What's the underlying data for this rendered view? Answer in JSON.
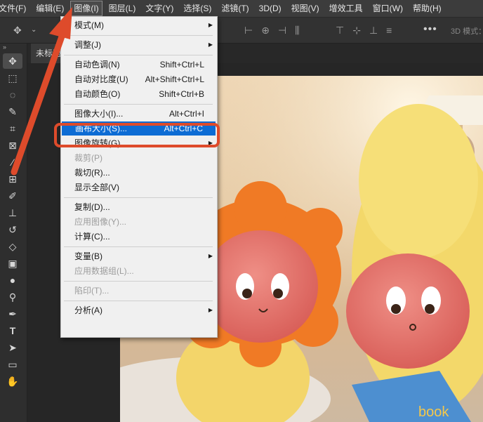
{
  "menubar": {
    "items": [
      "文件(F)",
      "编辑(E)",
      "图像(I)",
      "图层(L)",
      "文字(Y)",
      "选择(S)",
      "滤镜(T)",
      "3D(D)",
      "视图(V)",
      "增效工具",
      "窗口(W)",
      "帮助(H)"
    ],
    "active_index": 2
  },
  "options_bar": {
    "move_icon": "move-icon",
    "more_label": "•••",
    "mode_3d_label": "3D 模式："
  },
  "toolbar": {
    "collapse_label": "»",
    "tools": [
      "move-tool",
      "marquee-tool",
      "lasso-tool",
      "quick-select-tool",
      "crop-tool",
      "frame-tool",
      "eyedropper-tool",
      "healing-tool",
      "brush-tool",
      "stamp-tool",
      "history-brush-tool",
      "eraser-tool",
      "gradient-tool",
      "blur-tool",
      "dodge-tool",
      "pen-tool",
      "type-tool",
      "path-select-tool",
      "shape-tool",
      "hand-tool"
    ]
  },
  "tabs": {
    "document_tab": "未标题"
  },
  "image_menu": {
    "items": [
      {
        "label": "模式(M)",
        "shortcut": "",
        "submenu": true,
        "disabled": false,
        "highlighted": false
      },
      {
        "separator": true
      },
      {
        "label": "调整(J)",
        "shortcut": "",
        "submenu": true,
        "disabled": false,
        "highlighted": false
      },
      {
        "separator": true
      },
      {
        "label": "自动色调(N)",
        "shortcut": "Shift+Ctrl+L",
        "submenu": false,
        "disabled": false,
        "highlighted": false
      },
      {
        "label": "自动对比度(U)",
        "shortcut": "Alt+Shift+Ctrl+L",
        "submenu": false,
        "disabled": false,
        "highlighted": false
      },
      {
        "label": "自动颜色(O)",
        "shortcut": "Shift+Ctrl+B",
        "submenu": false,
        "disabled": false,
        "highlighted": false
      },
      {
        "separator": true
      },
      {
        "label": "图像大小(I)...",
        "shortcut": "Alt+Ctrl+I",
        "submenu": false,
        "disabled": false,
        "highlighted": false
      },
      {
        "label": "画布大小(S)...",
        "shortcut": "Alt+Ctrl+C",
        "submenu": false,
        "disabled": false,
        "highlighted": true
      },
      {
        "label": "图像旋转(G)",
        "shortcut": "",
        "submenu": true,
        "disabled": false,
        "highlighted": false
      },
      {
        "label": "裁剪(P)",
        "shortcut": "",
        "submenu": false,
        "disabled": true,
        "highlighted": false
      },
      {
        "label": "裁切(R)...",
        "shortcut": "",
        "submenu": false,
        "disabled": false,
        "highlighted": false
      },
      {
        "label": "显示全部(V)",
        "shortcut": "",
        "submenu": false,
        "disabled": false,
        "highlighted": false
      },
      {
        "separator": true
      },
      {
        "label": "复制(D)...",
        "shortcut": "",
        "submenu": false,
        "disabled": false,
        "highlighted": false
      },
      {
        "label": "应用图像(Y)...",
        "shortcut": "",
        "submenu": false,
        "disabled": true,
        "highlighted": false
      },
      {
        "label": "计算(C)...",
        "shortcut": "",
        "submenu": false,
        "disabled": false,
        "highlighted": false
      },
      {
        "separator": true
      },
      {
        "label": "变量(B)",
        "shortcut": "",
        "submenu": true,
        "disabled": false,
        "highlighted": false
      },
      {
        "label": "应用数据组(L)...",
        "shortcut": "",
        "submenu": false,
        "disabled": true,
        "highlighted": false
      },
      {
        "separator": true
      },
      {
        "label": "陷印(T)...",
        "shortcut": "",
        "submenu": false,
        "disabled": true,
        "highlighted": false
      },
      {
        "separator": true
      },
      {
        "label": "分析(A)",
        "shortcut": "",
        "submenu": true,
        "disabled": false,
        "highlighted": false
      }
    ]
  },
  "canvas": {
    "photo_labels": {
      "book_text": "book"
    }
  },
  "colors": {
    "menu_highlight": "#0d6cd4",
    "annotation_red": "#de4b2b",
    "menubar_bg": "#3c3c3c"
  }
}
